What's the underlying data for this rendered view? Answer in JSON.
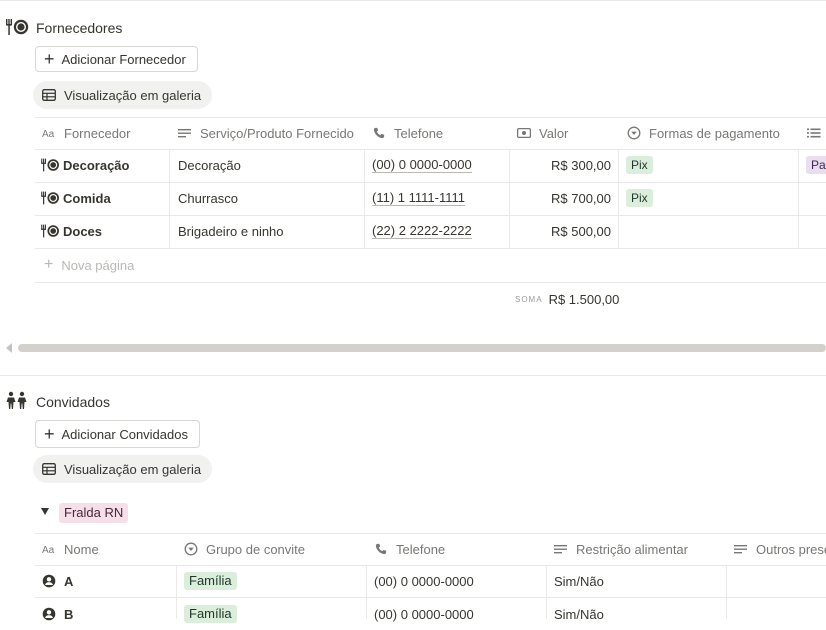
{
  "colors": {
    "text": "#37352f",
    "muted": "#787774",
    "tag_green_bg": "#dbeddb",
    "tag_green_text": "#1c3829",
    "tag_purple_bg": "#e8deee",
    "tag_purple_text": "#412454",
    "tag_pink_bg": "#f5e0e9",
    "tag_pink_text": "#4c2337"
  },
  "suppliers": {
    "title": "Fornecedores",
    "icon": "fork-plate-icon",
    "add_button": "Adicionar Fornecedor",
    "view_tab": "Visualização em galeria",
    "columns": [
      "Fornecedor",
      "Serviço/Produto Fornecido",
      "Telefone",
      "Valor",
      "Formas de pagamento"
    ],
    "rows": [
      {
        "name": "Decoração",
        "service": "Decoração",
        "phone": "(00) 0 0000-0000",
        "value": "R$ 300,00",
        "payment": "Pix",
        "extra": "Par"
      },
      {
        "name": "Comida",
        "service": "Churrasco",
        "phone": "(11) 1 1111-1111",
        "value": "R$ 700,00",
        "payment": "Pix",
        "extra": ""
      },
      {
        "name": "Doces",
        "service": "Brigadeiro e ninho",
        "phone": "(22) 2 2222-2222",
        "value": "R$ 500,00",
        "payment": "",
        "extra": ""
      }
    ],
    "new_page": "Nova página",
    "sum_label": "SOMA",
    "sum_value": "R$ 1.500,00"
  },
  "guests": {
    "title": "Convidados",
    "icon": "people-icon",
    "add_button": "Adicionar Convidados",
    "view_tab": "Visualização em galeria",
    "group_label": "Fralda RN",
    "columns": [
      "Nome",
      "Grupo de convite",
      "Telefone",
      "Restrição alimentar",
      "Outros prese"
    ],
    "rows": [
      {
        "name": "A",
        "group": "Família",
        "phone": "(00) 0 0000-0000",
        "restriction": "Sim/Não"
      },
      {
        "name": "B",
        "group": "Família",
        "phone": "(00) 0 0000-0000",
        "restriction": "Sim/Não"
      }
    ]
  }
}
